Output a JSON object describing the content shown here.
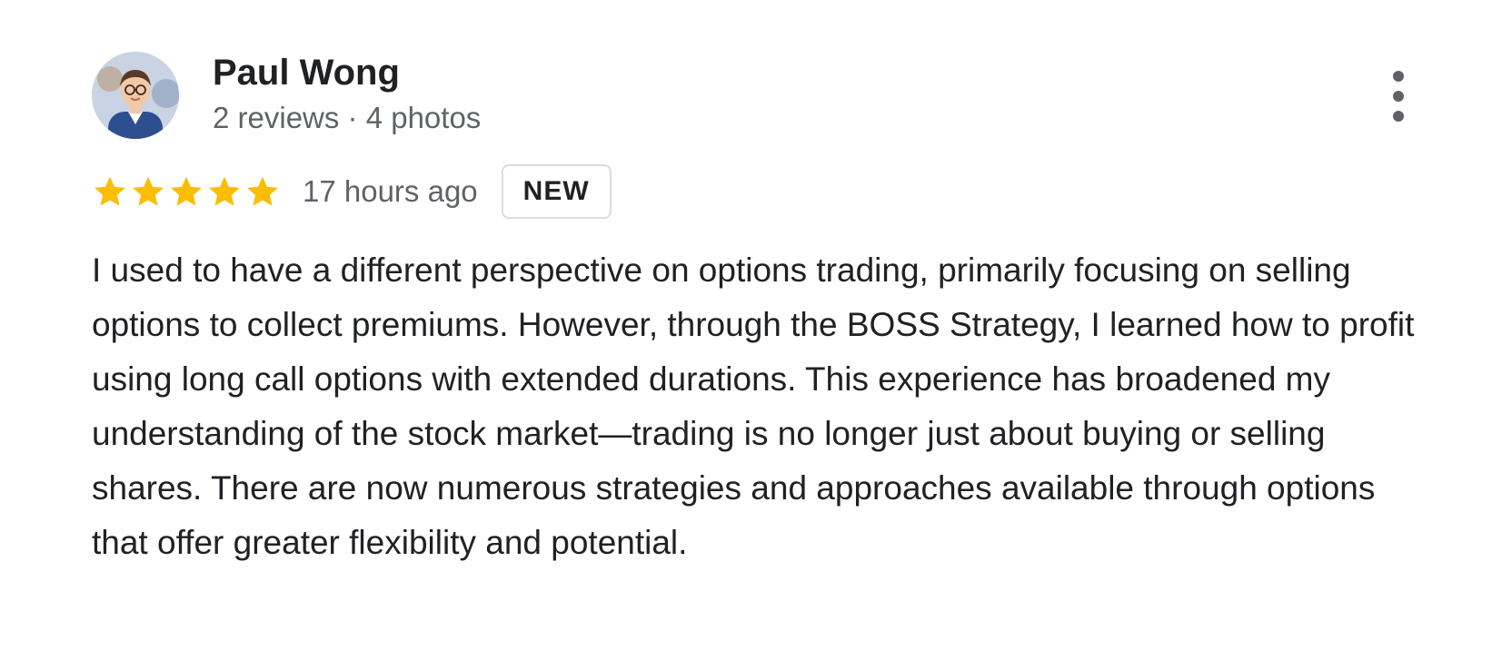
{
  "reviewer": {
    "name": "Paul Wong",
    "meta": "2 reviews · 4 photos"
  },
  "review": {
    "rating": 5,
    "max_rating": 5,
    "time": "17 hours ago",
    "badge": "NEW",
    "text": "I used to have a different perspective on options trading, primarily focusing on selling options to collect premiums. However, through the BOSS Strategy, I learned how to profit using long call options with extended durations. This experience has broadened my understanding of the stock market—trading is no longer just about buying or selling shares. There are now numerous strategies and approaches available through options that offer greater flexibility and potential."
  },
  "icons": {
    "star": "star-icon",
    "more": "more-vert-icon"
  },
  "colors": {
    "star": "#fbbc04",
    "name": "#202124",
    "secondary": "#5f6368",
    "badge_border": "#dadce0"
  }
}
